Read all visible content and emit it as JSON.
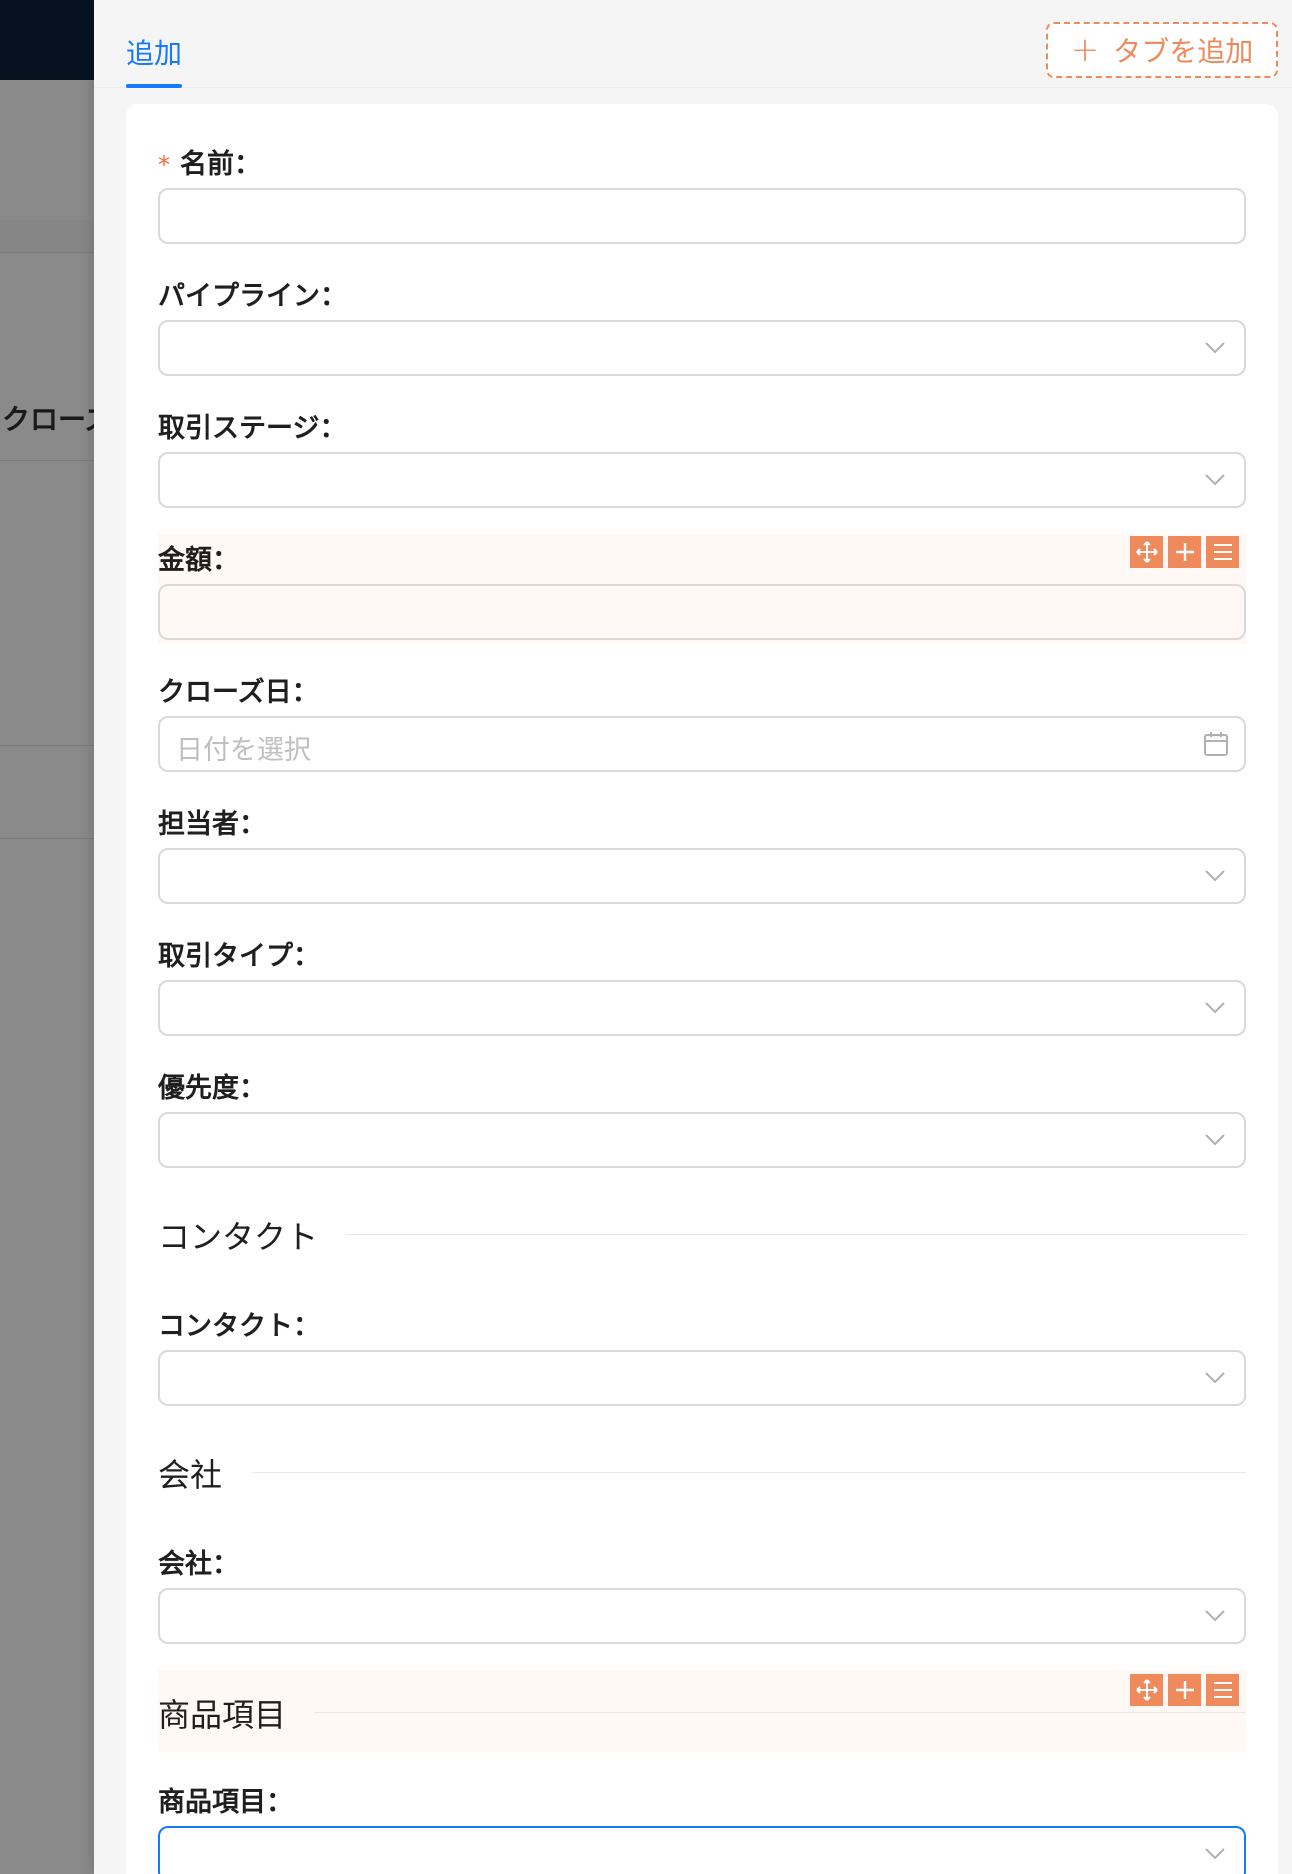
{
  "background": {
    "partial_text": "クローズ"
  },
  "tabs": {
    "active": "追加",
    "add_tab_label": "タブを追加"
  },
  "form": {
    "name_label": "名前：",
    "pipeline_label": "パイプライン：",
    "deal_stage_label": "取引ステージ：",
    "amount_label": "金額：",
    "close_date_label": "クローズ日：",
    "close_date_placeholder": "日付を選択",
    "owner_label": "担当者：",
    "deal_type_label": "取引タイプ：",
    "priority_label": "優先度：",
    "contact_section": "コンタクト",
    "contact_label": "コンタクト：",
    "company_section": "会社",
    "company_label": "会社：",
    "line_items_section": "商品項目",
    "line_items_label": "商品項目："
  },
  "colors": {
    "accent": "#1677ff",
    "designer_tools": "#ee8a5c",
    "required": "#ee6b3b"
  }
}
